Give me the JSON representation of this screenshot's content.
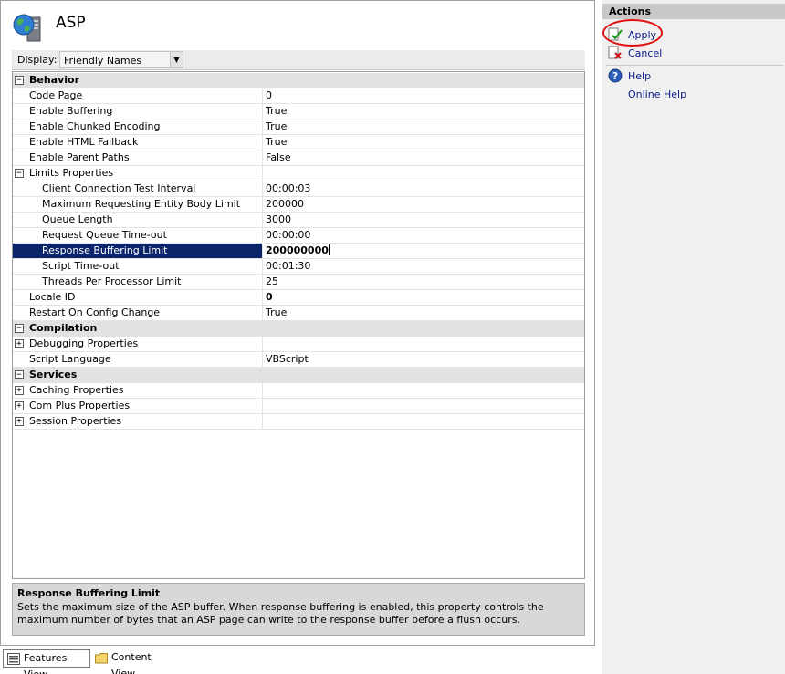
{
  "page": {
    "title": "ASP"
  },
  "toolbar": {
    "display_label": "Display:",
    "display_value": "Friendly Names"
  },
  "grid": {
    "rows": [
      {
        "kind": "cat",
        "label": "Behavior",
        "toggle": "−"
      },
      {
        "kind": "prop",
        "indent": 1,
        "name": "Code Page",
        "value": "0"
      },
      {
        "kind": "prop",
        "indent": 1,
        "name": "Enable Buffering",
        "value": "True"
      },
      {
        "kind": "prop",
        "indent": 1,
        "name": "Enable Chunked Encoding",
        "value": "True"
      },
      {
        "kind": "prop",
        "indent": 1,
        "name": "Enable HTML Fallback",
        "value": "True"
      },
      {
        "kind": "prop",
        "indent": 1,
        "name": "Enable Parent Paths",
        "value": "False"
      },
      {
        "kind": "group",
        "indent": 1,
        "name": "Limits Properties",
        "value": "",
        "toggle": "−"
      },
      {
        "kind": "prop",
        "indent": 2,
        "name": "Client Connection Test Interval",
        "value": "00:00:03"
      },
      {
        "kind": "prop",
        "indent": 2,
        "name": "Maximum Requesting Entity Body Limit",
        "value": "200000"
      },
      {
        "kind": "prop",
        "indent": 2,
        "name": "Queue Length",
        "value": "3000"
      },
      {
        "kind": "prop",
        "indent": 2,
        "name": "Request Queue Time-out",
        "value": "00:00:00"
      },
      {
        "kind": "prop",
        "indent": 2,
        "name": "Response Buffering Limit",
        "value": "200000000",
        "selected": true
      },
      {
        "kind": "prop",
        "indent": 2,
        "name": "Script Time-out",
        "value": "00:01:30"
      },
      {
        "kind": "prop",
        "indent": 2,
        "name": "Threads Per Processor Limit",
        "value": "25"
      },
      {
        "kind": "prop",
        "indent": 1,
        "name": "Locale ID",
        "value": "0",
        "bold": true
      },
      {
        "kind": "prop",
        "indent": 1,
        "name": "Restart On Config Change",
        "value": "True"
      },
      {
        "kind": "cat",
        "label": "Compilation",
        "toggle": "−"
      },
      {
        "kind": "group",
        "indent": 1,
        "name": "Debugging Properties",
        "value": "",
        "toggle": "+"
      },
      {
        "kind": "prop",
        "indent": 1,
        "name": "Script Language",
        "value": "VBScript"
      },
      {
        "kind": "cat",
        "label": "Services",
        "toggle": "−"
      },
      {
        "kind": "group",
        "indent": 1,
        "name": "Caching Properties",
        "value": "",
        "toggle": "+"
      },
      {
        "kind": "group",
        "indent": 1,
        "name": "Com Plus Properties",
        "value": "",
        "toggle": "+"
      },
      {
        "kind": "group",
        "indent": 1,
        "name": "Session Properties",
        "value": "",
        "toggle": "+"
      }
    ]
  },
  "description": {
    "title": "Response Buffering Limit",
    "text": "Sets the maximum size of the ASP buffer. When response buffering is enabled, this property controls the maximum number of bytes that an ASP page can write to the response buffer before a flush occurs."
  },
  "views": {
    "features": "Features View",
    "content": "Content View"
  },
  "actions": {
    "header": "Actions",
    "apply": "Apply",
    "cancel": "Cancel",
    "help": "Help",
    "online_help": "Online Help"
  },
  "colors": {
    "selection": "#0a246a",
    "link": "#0a1a8c",
    "highlight_circle": "#e01010"
  }
}
